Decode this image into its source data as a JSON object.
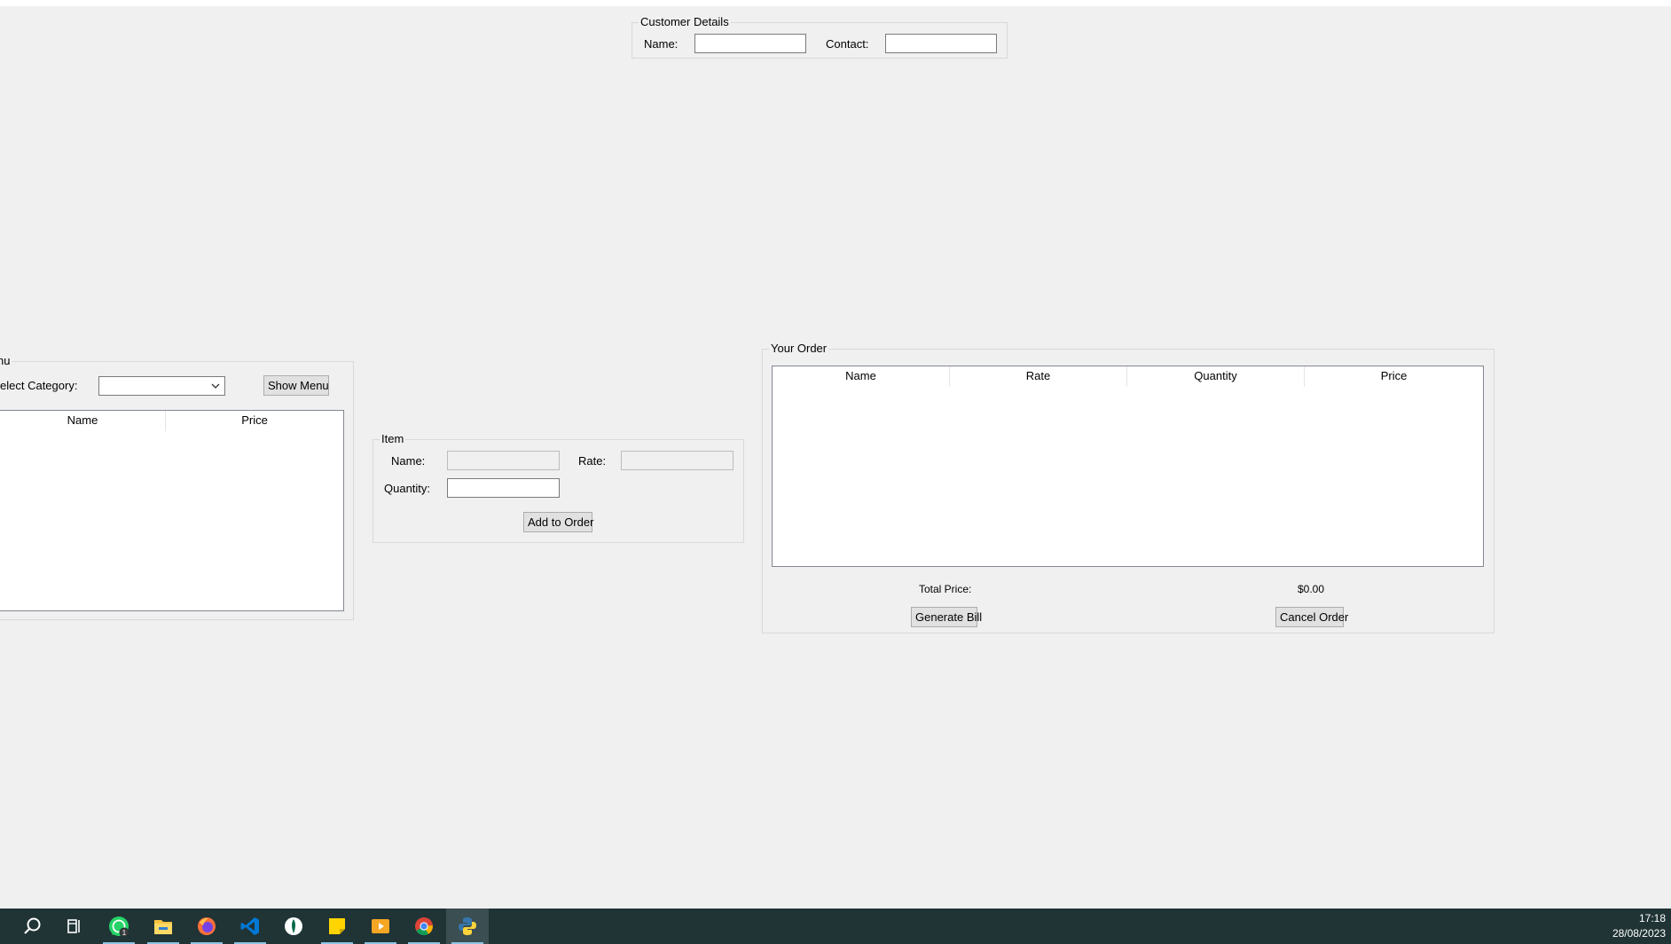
{
  "customer_details": {
    "title": "Customer Details",
    "name_label": "Name:",
    "name_value": "",
    "contact_label": "Contact:",
    "contact_value": ""
  },
  "menu": {
    "title": "nu",
    "category_label": "elect Category:",
    "category_value": "",
    "show_menu_button": "Show Menu",
    "columns": [
      "Name",
      "Price"
    ],
    "rows": []
  },
  "item": {
    "title": "Item",
    "name_label": "Name:",
    "name_value": "",
    "rate_label": "Rate:",
    "rate_value": "",
    "quantity_label": "Quantity:",
    "quantity_value": "",
    "add_button": "Add to Order"
  },
  "order": {
    "title": "Your Order",
    "columns": [
      "Name",
      "Rate",
      "Quantity",
      "Price"
    ],
    "rows": [],
    "total_label": "Total Price:",
    "total_value": "$0.00",
    "generate_button": "Generate Bill",
    "cancel_button": "Cancel Order"
  },
  "taskbar": {
    "icons": [
      "search-icon",
      "task-view-icon",
      "whatsapp-icon",
      "file-explorer-icon",
      "firefox-icon",
      "vscode-icon",
      "mongodb-compass-icon",
      "sticky-notes-icon",
      "media-player-icon",
      "chrome-icon",
      "python-icon"
    ],
    "whatsapp_badge": "1",
    "time": "17:18",
    "date": "28/08/2023"
  }
}
